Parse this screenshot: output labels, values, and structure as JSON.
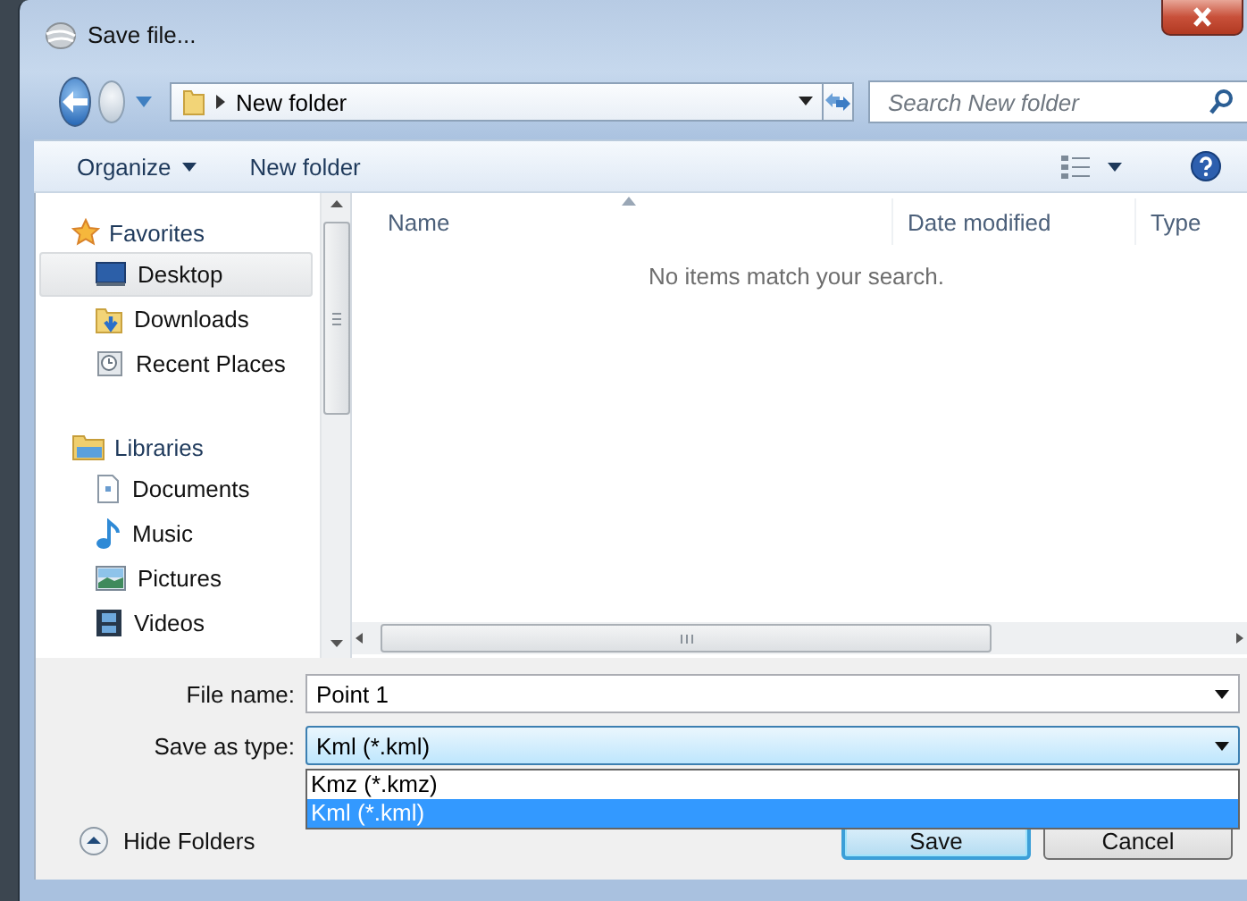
{
  "window": {
    "title": "Save file..."
  },
  "address_bar": {
    "path": "New folder"
  },
  "search": {
    "placeholder": "Search New folder"
  },
  "toolbar": {
    "items": [
      {
        "label": "Organize",
        "kind": "menu"
      },
      {
        "label": "New folder",
        "kind": "button"
      }
    ]
  },
  "sidebar": {
    "groups": [
      {
        "label": "Favorites",
        "kind": "favorites",
        "children": [
          {
            "label": "Desktop",
            "kind": "desktop",
            "selected": true
          },
          {
            "label": "Downloads",
            "kind": "downloads",
            "selected": false
          },
          {
            "label": "Recent Places",
            "kind": "recent",
            "selected": false
          }
        ]
      },
      {
        "label": "Libraries",
        "kind": "libraries",
        "children": [
          {
            "label": "Documents",
            "kind": "documents",
            "selected": false
          },
          {
            "label": "Music",
            "kind": "music",
            "selected": false
          },
          {
            "label": "Pictures",
            "kind": "pictures",
            "selected": false
          },
          {
            "label": "Videos",
            "kind": "videos",
            "selected": false
          }
        ]
      }
    ]
  },
  "file_list": {
    "columns": [
      {
        "label": "Name",
        "sorted": true
      },
      {
        "label": "Date modified",
        "sorted": false
      },
      {
        "label": "Type",
        "sorted": false
      }
    ],
    "empty_message": "No items match your search."
  },
  "form": {
    "file_name": {
      "label": "File name:",
      "value": "Point 1"
    },
    "save_type": {
      "label": "Save as type:",
      "value": "Kml (*.kml)",
      "expanded": true,
      "options": [
        {
          "label": "Kmz (*.kmz)",
          "selected": false
        },
        {
          "label": "Kml (*.kml)",
          "selected": true
        }
      ]
    }
  },
  "hide_folders": {
    "label": "Hide Folders"
  },
  "buttons": [
    {
      "label": "Save",
      "default": true
    },
    {
      "label": "Cancel",
      "default": false
    }
  ]
}
